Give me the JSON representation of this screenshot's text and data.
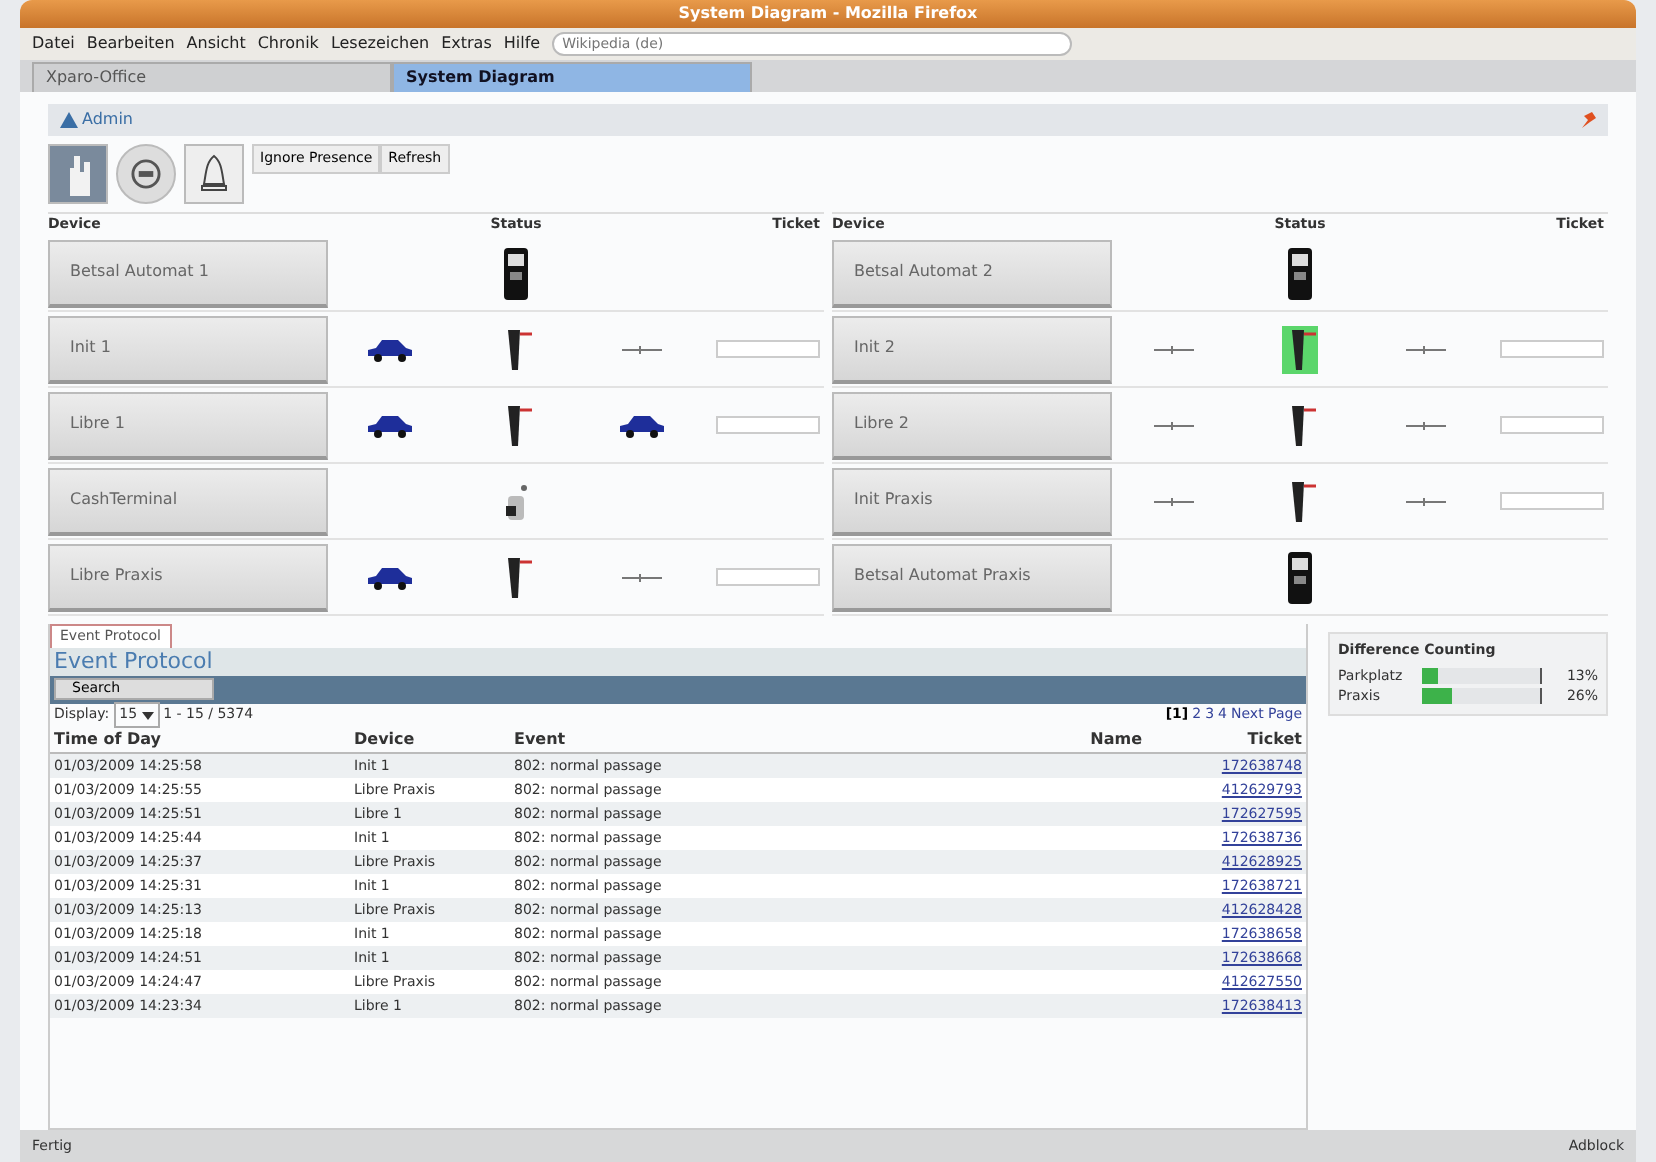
{
  "window": {
    "title": "System Diagram - Mozilla Firefox"
  },
  "menu": [
    "Datei",
    "Bearbeiten",
    "Ansicht",
    "Chronik",
    "Lesezeichen",
    "Extras",
    "Hilfe"
  ],
  "search": {
    "placeholder": "Wikipedia (de)"
  },
  "tabs": [
    {
      "label": "Xparo-Office",
      "selected": false
    },
    {
      "label": "System Diagram",
      "selected": true
    }
  ],
  "page_header": {
    "user": "Admin"
  },
  "toolbar_buttons": [
    "Ignore Presence",
    "Refresh"
  ],
  "device_panels": [
    {
      "columns": [
        "Device",
        "Status",
        "Ticket"
      ],
      "rows": [
        {
          "name": "Betsal Automat 1",
          "has_ticket": false,
          "status": [
            {
              "kind": "empty"
            },
            {
              "kind": "machine"
            },
            {
              "kind": "empty"
            }
          ]
        },
        {
          "name": "Init 1",
          "has_ticket": true,
          "status": [
            {
              "kind": "car"
            },
            {
              "kind": "barrier",
              "active": false
            },
            {
              "kind": "loop"
            }
          ]
        },
        {
          "name": "Libre 1",
          "has_ticket": true,
          "status": [
            {
              "kind": "car"
            },
            {
              "kind": "barrier",
              "active": false
            },
            {
              "kind": "car"
            }
          ]
        },
        {
          "name": "CashTerminal",
          "has_ticket": false,
          "status": [
            {
              "kind": "empty"
            },
            {
              "kind": "terminal"
            },
            {
              "kind": "empty"
            }
          ]
        },
        {
          "name": "Libre Praxis",
          "has_ticket": true,
          "status": [
            {
              "kind": "car"
            },
            {
              "kind": "barrier",
              "active": false
            },
            {
              "kind": "loop"
            }
          ]
        }
      ]
    },
    {
      "columns": [
        "Device",
        "Status",
        "Ticket"
      ],
      "rows": [
        {
          "name": "Betsal Automat 2",
          "has_ticket": false,
          "status": [
            {
              "kind": "empty"
            },
            {
              "kind": "machine"
            },
            {
              "kind": "empty"
            }
          ]
        },
        {
          "name": "Init 2",
          "has_ticket": true,
          "status": [
            {
              "kind": "loop"
            },
            {
              "kind": "barrier",
              "active": true
            },
            {
              "kind": "loop"
            }
          ]
        },
        {
          "name": "Libre 2",
          "has_ticket": true,
          "status": [
            {
              "kind": "loop"
            },
            {
              "kind": "barrier",
              "active": false
            },
            {
              "kind": "loop"
            }
          ]
        },
        {
          "name": "Init Praxis",
          "has_ticket": true,
          "status": [
            {
              "kind": "loop"
            },
            {
              "kind": "barrier",
              "active": false
            },
            {
              "kind": "loop"
            }
          ]
        },
        {
          "name": "Betsal Automat Praxis",
          "has_ticket": false,
          "status": [
            {
              "kind": "empty"
            },
            {
              "kind": "machine"
            },
            {
              "kind": "empty"
            }
          ]
        }
      ]
    }
  ],
  "event_protocol": {
    "tab": "Event Protocol",
    "title": "Event Protocol",
    "search_button": "Search",
    "display_label": "Display:",
    "page_size": "15",
    "range": "1 - 15 / 5374",
    "pages": [
      {
        "label": "[1]",
        "selected": true
      },
      {
        "label": "2",
        "selected": false
      },
      {
        "label": "3",
        "selected": false
      },
      {
        "label": "4",
        "selected": false
      },
      {
        "label": "Next Page",
        "selected": false
      }
    ],
    "columns": [
      "Time of Day",
      "Device",
      "Event",
      "Name",
      "Ticket"
    ],
    "rows": [
      {
        "time": "01/03/2009 14:25:58",
        "device": "Init 1",
        "event": "802: normal passage",
        "ticket": "172638748"
      },
      {
        "time": "01/03/2009 14:25:55",
        "device": "Libre Praxis",
        "event": "802: normal passage",
        "ticket": "412629793"
      },
      {
        "time": "01/03/2009 14:25:51",
        "device": "Libre 1",
        "event": "802: normal passage",
        "ticket": "172627595"
      },
      {
        "time": "01/03/2009 14:25:44",
        "device": "Init 1",
        "event": "802: normal passage",
        "ticket": "172638736"
      },
      {
        "time": "01/03/2009 14:25:37",
        "device": "Libre Praxis",
        "event": "802: normal passage",
        "ticket": "412628925"
      },
      {
        "time": "01/03/2009 14:25:31",
        "device": "Init 1",
        "event": "802: normal passage",
        "ticket": "172638721"
      },
      {
        "time": "01/03/2009 14:25:13",
        "device": "Libre Praxis",
        "event": "802: normal passage",
        "ticket": "412628428"
      },
      {
        "time": "01/03/2009 14:25:18",
        "device": "Init 1",
        "event": "802: normal passage",
        "ticket": "172638658"
      },
      {
        "time": "01/03/2009 14:24:51",
        "device": "Init 1",
        "event": "802: normal passage",
        "ticket": "172638668"
      },
      {
        "time": "01/03/2009 14:24:47",
        "device": "Libre Praxis",
        "event": "802: normal passage",
        "ticket": "412627550"
      },
      {
        "time": "01/03/2009 14:23:34",
        "device": "Libre 1",
        "event": "802: normal passage",
        "ticket": "172638413"
      }
    ]
  },
  "difference_counting": {
    "title": "Difference Counting",
    "items": [
      {
        "label": "Parkplatz",
        "level": 0.13,
        "reading": "13%"
      },
      {
        "label": "Praxis",
        "level": 0.26,
        "reading": "26%"
      }
    ]
  },
  "status_bar": {
    "left": "Fertig",
    "right": "Adblock"
  }
}
